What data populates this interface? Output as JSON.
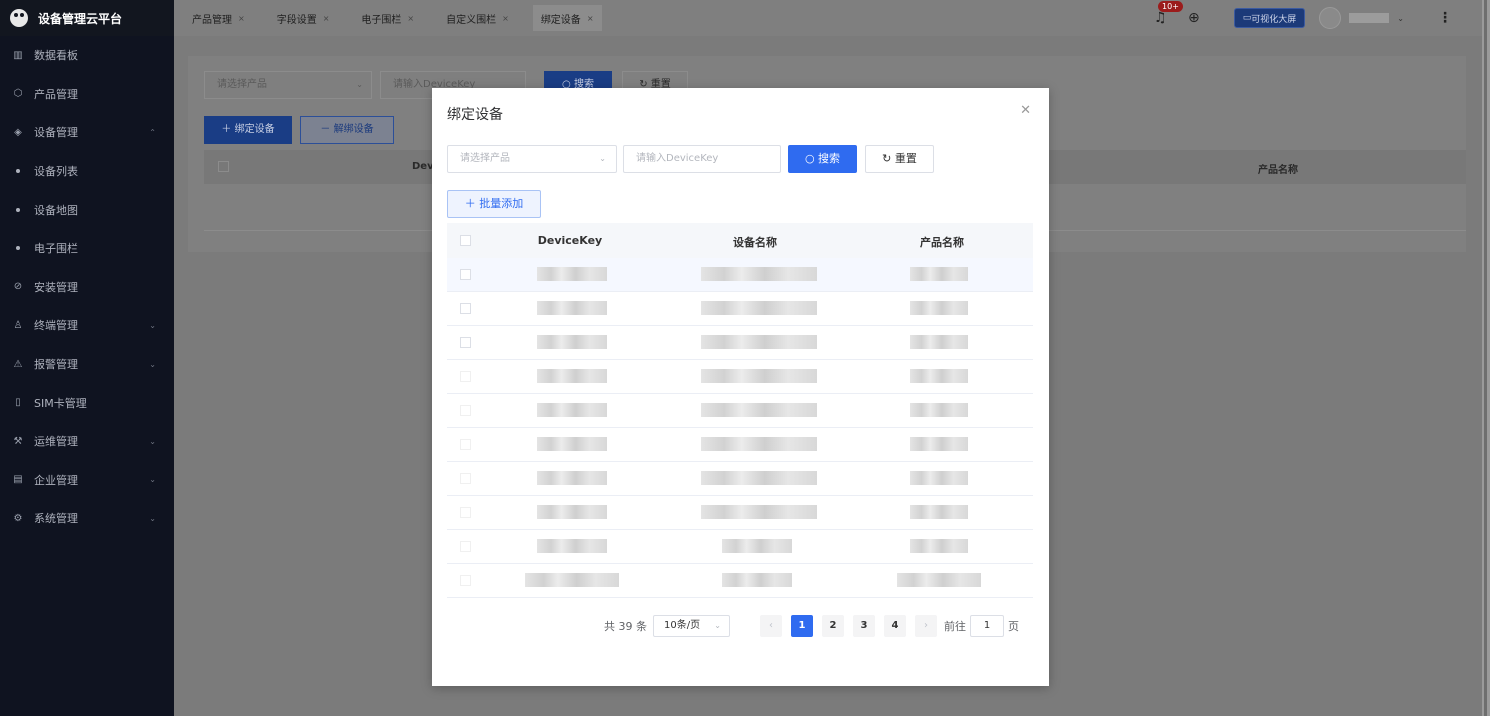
{
  "app": {
    "title": "设备管理云平台"
  },
  "sidebar": {
    "items": [
      {
        "label": "数据看板",
        "icon": "bar-chart-icon",
        "glyph": "▥"
      },
      {
        "label": "产品管理",
        "icon": "cube-icon",
        "glyph": "⬡"
      },
      {
        "label": "设备管理",
        "icon": "layers-icon",
        "glyph": "◈",
        "chev": "⌃"
      },
      {
        "label": "设备列表",
        "sub": true
      },
      {
        "label": "设备地图",
        "sub": true
      },
      {
        "label": "电子围栏",
        "sub": true
      },
      {
        "label": "安装管理",
        "icon": "check-circle-icon",
        "glyph": "⊘"
      },
      {
        "label": "终端管理",
        "icon": "user-icon",
        "glyph": "♙",
        "chev": "⌄"
      },
      {
        "label": "报警管理",
        "icon": "alarm-icon",
        "glyph": "⚠",
        "chev": "⌄"
      },
      {
        "label": "SIM卡管理",
        "icon": "sim-card-icon",
        "glyph": "▯"
      },
      {
        "label": "运维管理",
        "icon": "tool-icon",
        "glyph": "⚒",
        "chev": "⌄"
      },
      {
        "label": "企业管理",
        "icon": "building-icon",
        "glyph": "▤",
        "chev": "⌄"
      },
      {
        "label": "系统管理",
        "icon": "gear-icon",
        "glyph": "⚙",
        "chev": "⌄"
      }
    ]
  },
  "topbar": {
    "tabs": [
      {
        "label": "产品管理",
        "close": "×"
      },
      {
        "label": "字段设置",
        "close": "×"
      },
      {
        "label": "电子围栏",
        "close": "×"
      },
      {
        "label": "自定义围栏",
        "close": "×"
      },
      {
        "label": "绑定设备",
        "close": "×",
        "active": true
      }
    ],
    "notification_badge": "10+",
    "screen_button": "可视化大屏"
  },
  "page": {
    "product_placeholder": "请选择产品",
    "devicekey_placeholder": "请输入DeviceKey",
    "search_label": "搜索",
    "reset_label": "重置",
    "bind_label": "绑定设备",
    "unbind_label": "解绑设备",
    "col_device": "Dev",
    "col_product": "产品名称"
  },
  "modal": {
    "title": "绑定设备",
    "product_placeholder": "请选择产品",
    "devicekey_placeholder": "请输入DeviceKey",
    "search_label": "搜索",
    "reset_label": "重置",
    "batch_add_label": "批量添加",
    "columns": [
      "DeviceKey",
      "设备名称",
      "产品名称"
    ],
    "pagination": {
      "total_text": "共 39 条",
      "page_size": "10条/页",
      "pages": [
        "1",
        "2",
        "3",
        "4"
      ],
      "current_page": "1",
      "goto_label": "前往",
      "goto_value": "1",
      "page_suffix": "页"
    }
  }
}
